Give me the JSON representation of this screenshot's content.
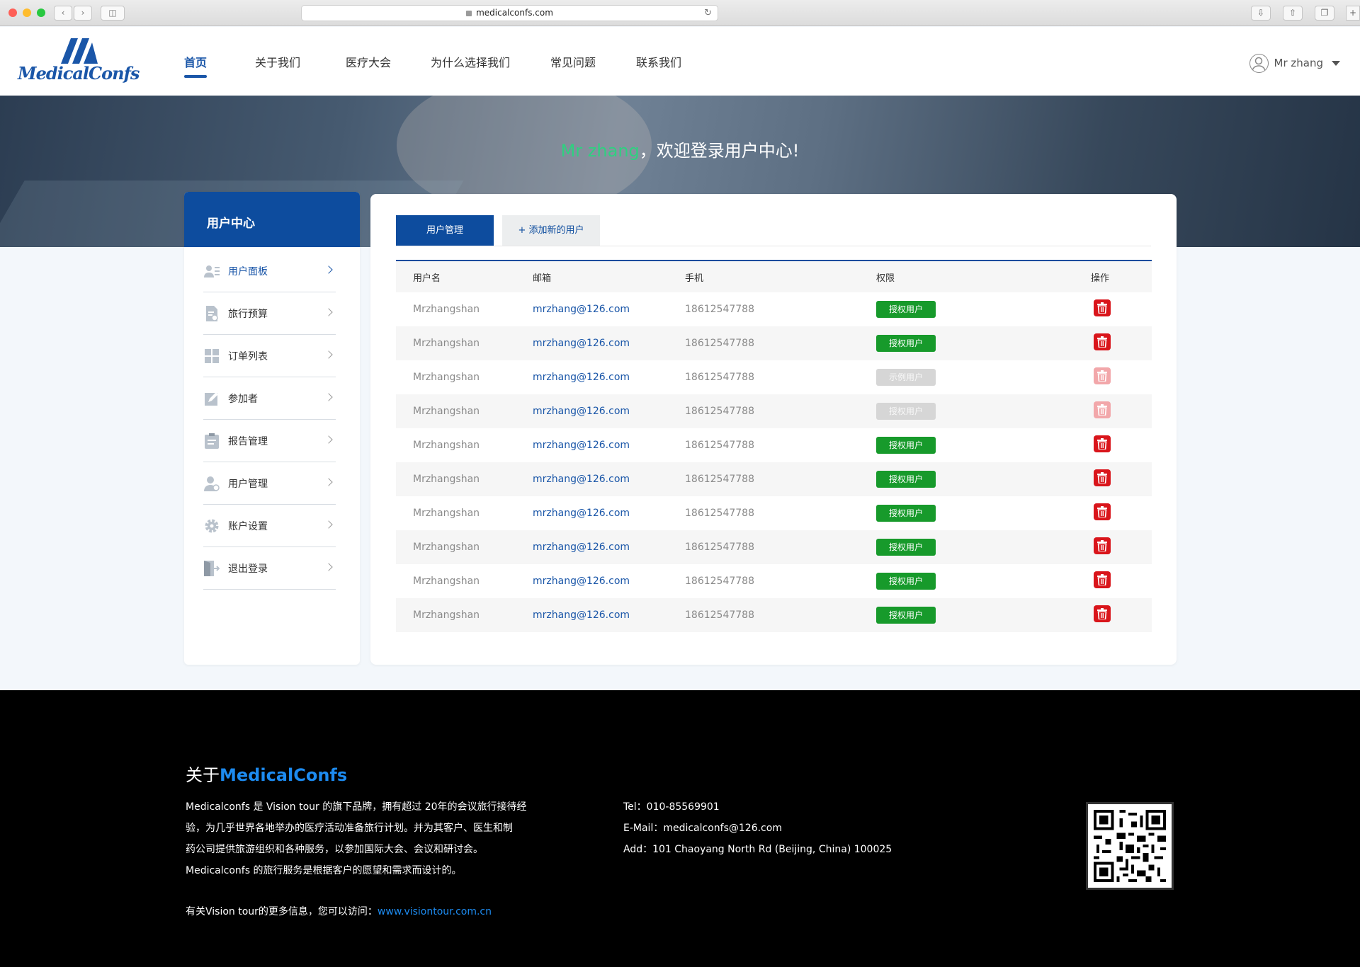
{
  "browser": {
    "url": "medicalconfs.com",
    "traffic_lights": [
      "#fe5f57",
      "#febc2e",
      "#28c840"
    ]
  },
  "header": {
    "logo_text": "MedicalConfs",
    "nav": [
      {
        "label": "首页",
        "active": true
      },
      {
        "label": "关于我们"
      },
      {
        "label": "医疗大会"
      },
      {
        "label": "为什么选择我们"
      },
      {
        "label": "常见问题"
      },
      {
        "label": "联系我们"
      }
    ],
    "user_name": "Mr zhang"
  },
  "banner": {
    "user_name": "Mr zhang",
    "welcome_suffix": "，欢迎登录用户中心!"
  },
  "sidebar": {
    "title": "用户中心",
    "items": [
      {
        "label": "用户面板",
        "icon": "user-panel-icon",
        "active": true
      },
      {
        "label": "旅行预算",
        "icon": "budget-icon"
      },
      {
        "label": "订单列表",
        "icon": "grid-icon"
      },
      {
        "label": "参加者",
        "icon": "edit-icon"
      },
      {
        "label": "报告管理",
        "icon": "clipboard-icon"
      },
      {
        "label": "用户管理",
        "icon": "user-manage-icon"
      },
      {
        "label": "账户设置",
        "icon": "gear-icon"
      },
      {
        "label": "退出登录",
        "icon": "logout-icon"
      }
    ]
  },
  "main": {
    "tabs": [
      {
        "label": "用户管理",
        "active": true
      },
      {
        "label": "+ 添加新的用户"
      }
    ],
    "columns": [
      "用户名",
      "邮箱",
      "手机",
      "权限",
      "操作"
    ],
    "rows": [
      {
        "username": "Mrzhangshan",
        "email": "mrzhang@126.com",
        "phone": "18612547788",
        "permission": "授权用户",
        "enabled": true
      },
      {
        "username": "Mrzhangshan",
        "email": "mrzhang@126.com",
        "phone": "18612547788",
        "permission": "授权用户",
        "enabled": true
      },
      {
        "username": "Mrzhangshan",
        "email": "mrzhang@126.com",
        "phone": "18612547788",
        "permission": "示例用户",
        "enabled": false
      },
      {
        "username": "Mrzhangshan",
        "email": "mrzhang@126.com",
        "phone": "18612547788",
        "permission": "授权用户",
        "enabled": false
      },
      {
        "username": "Mrzhangshan",
        "email": "mrzhang@126.com",
        "phone": "18612547788",
        "permission": "授权用户",
        "enabled": true
      },
      {
        "username": "Mrzhangshan",
        "email": "mrzhang@126.com",
        "phone": "18612547788",
        "permission": "授权用户",
        "enabled": true
      },
      {
        "username": "Mrzhangshan",
        "email": "mrzhang@126.com",
        "phone": "18612547788",
        "permission": "授权用户",
        "enabled": true
      },
      {
        "username": "Mrzhangshan",
        "email": "mrzhang@126.com",
        "phone": "18612547788",
        "permission": "授权用户",
        "enabled": true
      },
      {
        "username": "Mrzhangshan",
        "email": "mrzhang@126.com",
        "phone": "18612547788",
        "permission": "授权用户",
        "enabled": true
      },
      {
        "username": "Mrzhangshan",
        "email": "mrzhang@126.com",
        "phone": "18612547788",
        "permission": "授权用户",
        "enabled": true
      }
    ]
  },
  "footer": {
    "title_prefix": "关于",
    "title_brand": "MedicalConfs",
    "description": [
      "Medicalconfs 是 Vision tour 的旗下品牌，拥有超过 20年的会议旅行接待经",
      "验，为几乎世界各地举办的医疗活动准备旅行计划。并为其客户、医生和制",
      "药公司提供旅游组织和各种服务，以参加国际大会、会议和研讨会。",
      "Medicalconfs 的旅行服务是根据客户的愿望和需求而设计的。"
    ],
    "more_text": "有关Vision tour的更多信息，您可以访问：",
    "more_link": "www.visiontour.com.cn",
    "tel": "Tel：010-85569901",
    "email": "E-Mail：medicalconfs@126.com",
    "address": "Add：101 Chaoyang North Rd (Beijing, China) 100025"
  },
  "colors": {
    "primary": "#0d4c9e",
    "accent_green": "#2fd080",
    "badge_green": "#179a2b",
    "delete_red": "#d9151b",
    "footer_link": "#1d8bf0"
  }
}
